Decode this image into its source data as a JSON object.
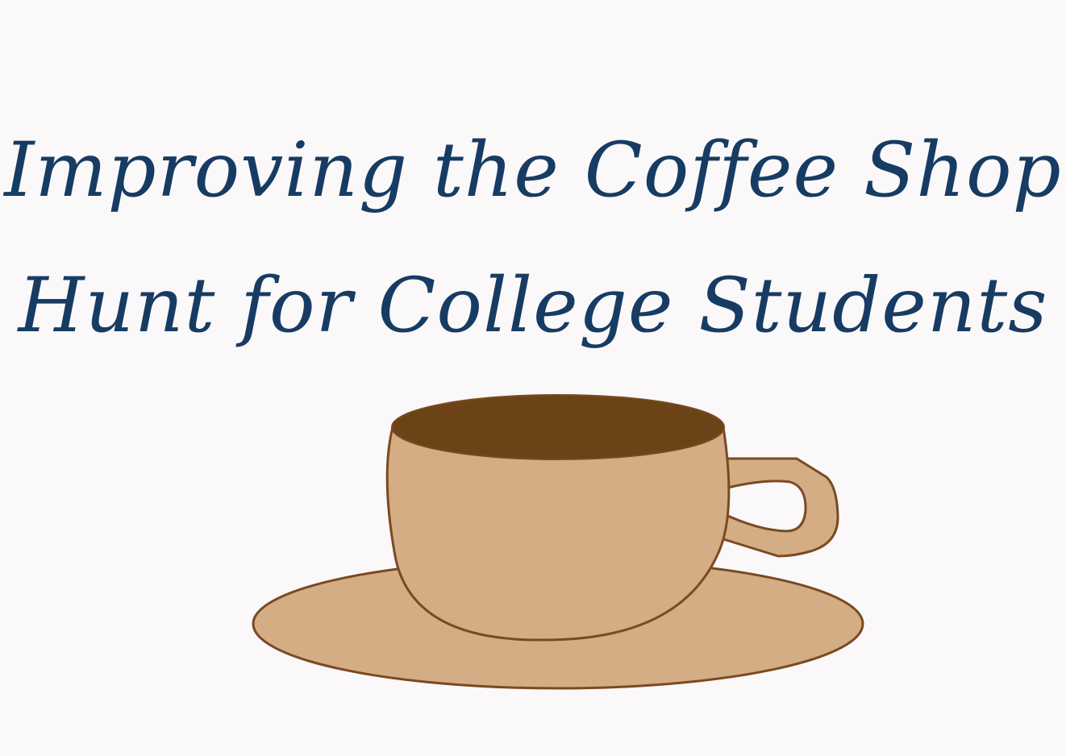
{
  "title": {
    "line1": "Improving the Coffee Shop",
    "line2": "Hunt for College Students"
  },
  "colors": {
    "background": "#fbf8f9",
    "title_text": "#173c63",
    "cup_fill": "#d4ad85",
    "coffee": "#6b4316",
    "outline": "#7a4a22"
  }
}
